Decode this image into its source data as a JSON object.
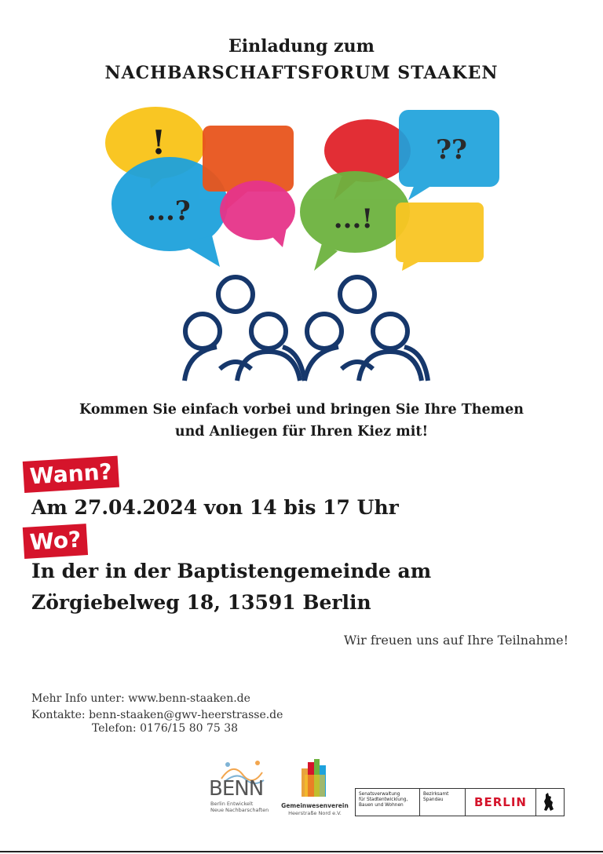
{
  "header": {
    "line1": "Einladung zum",
    "line2": "NACHBARSCHAFTSFORUM  STAAKEN"
  },
  "illustration": {
    "bubble_texts": [
      "!",
      "...?",
      "??",
      "...!"
    ],
    "colors": {
      "yellow": "#f9c623",
      "blue": "#1ea2dc",
      "orange": "#e8551d",
      "pink": "#e6348a",
      "red": "#e1232b",
      "green": "#6db33f",
      "people": "#16376b"
    }
  },
  "intro": {
    "line1": "Kommen Sie einfach vorbei und bringen Sie Ihre Themen",
    "line2": "und Anliegen für Ihren Kiez mit!"
  },
  "when": {
    "label": "Wann?",
    "text": "Am 27.04.2024 von 14 bis 17 Uhr"
  },
  "where": {
    "label": "Wo?",
    "line1": "In der in der Baptistengemeinde am",
    "line2": "Zörgiebelweg 18, 13591 Berlin"
  },
  "closing": "Wir freuen uns auf Ihre Teilnahme!",
  "contact": {
    "info": "Mehr Info unter: www.benn-staaken.de",
    "email": "Kontakte: benn-staaken@gwv-heerstrasse.de",
    "phone": "Telefon: 0176/15 80 75 38"
  },
  "logos": {
    "benn_word": "BENN",
    "benn_sub1": "Berlin Entwickelt",
    "benn_sub2": "Neue Nachbarschaften",
    "gwv_name": "Gemeinwesenverein",
    "gwv_sub": "Heerstraße Nord e.V.",
    "senat_1": "Senatsverwaltung",
    "senat_2": "für Stadtentwicklung,",
    "senat_3": "Bauen und Wohnen",
    "bezirk_1": "Bezirksamt",
    "bezirk_2": "Spandau",
    "berlin": "BERLIN"
  },
  "accent_color": "#d5142b"
}
